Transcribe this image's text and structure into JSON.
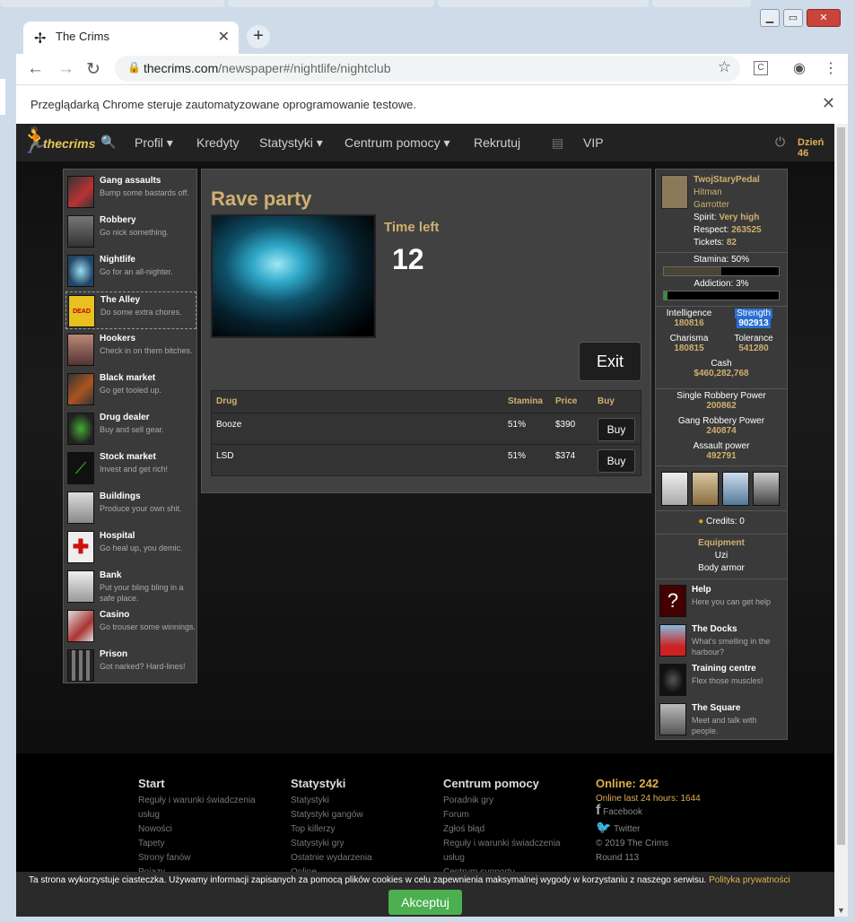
{
  "browser": {
    "tab_title": "The Crims",
    "new_tab": "+",
    "url_host": "thecrims.com",
    "url_path": "/newspaper#/nightlife/nightclub",
    "infobar_text": "Przeglądarką Chrome steruje zautomatyzowane oprogramowanie testowe."
  },
  "site": {
    "logo": "thecrims",
    "nav": [
      "Profil",
      "Kredyty",
      "Statystyki",
      "Centrum pomocy",
      "Rekrutuj",
      "VIP"
    ],
    "day": "Dzień 46"
  },
  "left_menu": [
    {
      "name": "Gang assaults",
      "desc": "Bump some bastards off."
    },
    {
      "name": "Robbery",
      "desc": "Go nick something."
    },
    {
      "name": "Nightlife",
      "desc": "Go for an all-nighter."
    },
    {
      "name": "The Alley",
      "desc": "Do some extra chores."
    },
    {
      "name": "Hookers",
      "desc": "Check in on them bitches."
    },
    {
      "name": "Black market",
      "desc": "Go get tooled up."
    },
    {
      "name": "Drug dealer",
      "desc": "Buy and sell gear."
    },
    {
      "name": "Stock market",
      "desc": "Invest and get rich!"
    },
    {
      "name": "Buildings",
      "desc": "Produce your own shit."
    },
    {
      "name": "Hospital",
      "desc": "Go heal up, you demic."
    },
    {
      "name": "Bank",
      "desc": "Put your bling bling in a safe place."
    },
    {
      "name": "Casino",
      "desc": "Go trouser some winnings."
    },
    {
      "name": "Prison",
      "desc": "Got narked? Hard-lines!"
    }
  ],
  "rave": {
    "title": "Rave party",
    "time_left_label": "Time left",
    "time_left": "12",
    "exit_label": "Exit",
    "columns": [
      "Drug",
      "Stamina",
      "Price",
      "Buy"
    ],
    "rows": [
      {
        "drug": "Booze",
        "stamina": "51%",
        "price": "$390",
        "buy": "Buy"
      },
      {
        "drug": "LSD",
        "stamina": "51%",
        "price": "$374",
        "buy": "Buy"
      }
    ]
  },
  "user": {
    "name": "TwojStaryPedal",
    "rank": "Hitman",
    "title2": "Garrotter",
    "spirit_label": "Spirit:",
    "spirit": "Very high",
    "respect_label": "Respect:",
    "respect": "263525",
    "tickets_label": "Tickets:",
    "tickets": "82",
    "stamina_label": "Stamina: 50%",
    "stamina_fraction": 0.5,
    "addiction_label": "Addiction: 3%",
    "addiction_fraction": 0.03,
    "intelligence_label": "Intelligence",
    "intelligence": "180816",
    "strength_label": "Strength",
    "strength": "902913",
    "charisma_label": "Charisma",
    "charisma": "180815",
    "tolerance_label": "Tolerance",
    "tolerance": "541280",
    "cash_label": "Cash",
    "cash": "$460,282,768",
    "single_label": "Single Robbery Power",
    "single": "200862",
    "gang_label": "Gang Robbery Power",
    "gang": "240874",
    "assault_label": "Assault power",
    "assault": "492791",
    "credits": "Credits: 0",
    "equipment_label": "Equipment",
    "equipment": [
      "Uzi",
      "Body armor"
    ]
  },
  "right_links": [
    {
      "name": "Help",
      "desc": "Here you can get help"
    },
    {
      "name": "The Docks",
      "desc": "What's smelling in the harbour?"
    },
    {
      "name": "Training centre",
      "desc": "Flex those muscles!"
    },
    {
      "name": "The Square",
      "desc": "Meet and talk with people."
    }
  ],
  "footer": {
    "start": {
      "h": "Start",
      "links": [
        "Reguły i warunki świadczenia usług",
        "Nowości",
        "Tapety",
        "Strony fanów",
        "Pojazy"
      ]
    },
    "stats": {
      "h": "Statystyki",
      "links": [
        "Statystyki",
        "Statystyki gangów",
        "Top killerzy",
        "Statystyki gry",
        "Ostatnie wydarzenia",
        "Online"
      ]
    },
    "help": {
      "h": "Centrum pomocy",
      "links": [
        "Poradnik gry",
        "Forum",
        "Zgłoś błąd",
        "Reguły i warunki świadczenia usług",
        "Centrum supportu"
      ]
    },
    "online": "Online: 242",
    "online24": "Online last 24 hours: 1644",
    "facebook": "Facebook",
    "twitter": "Twitter",
    "copyright": "© 2019 The Crims",
    "round": "Round 113"
  },
  "cookie": {
    "text": "Ta strona wykorzystuje ciasteczka. Używamy informacji zapisanych za pomocą plików cookies w celu zapewnienia maksymalnej wygody w korzystaniu z naszego serwisu.",
    "policy": "Polityka prywatności",
    "accept": "Akceptuj"
  },
  "colors": {
    "gold": "#d0b070",
    "accept": "#4caf50",
    "stamina_bar": "#4a4436",
    "addiction_bar": "#3d8b3d",
    "strength_highlight": "#2a6fd0"
  }
}
